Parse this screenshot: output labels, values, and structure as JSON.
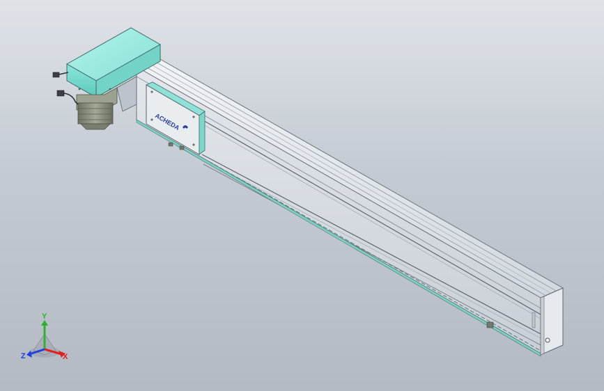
{
  "viewport": {
    "background_top": "#dfe3e8",
    "background_bottom": "#b3bac3"
  },
  "model": {
    "name": "linear-module-assembly",
    "motor_cover_color": "#8fe6dc",
    "rail_color": "#dfe4ea",
    "motor_color": "#8a8e7e",
    "carriage_logo": "ACHEDA"
  },
  "triad": {
    "x_label": "X",
    "y_label": "Y",
    "z_label": "Z",
    "x_color": "#e02020",
    "y_color": "#30b030",
    "z_color": "#2040e0"
  }
}
